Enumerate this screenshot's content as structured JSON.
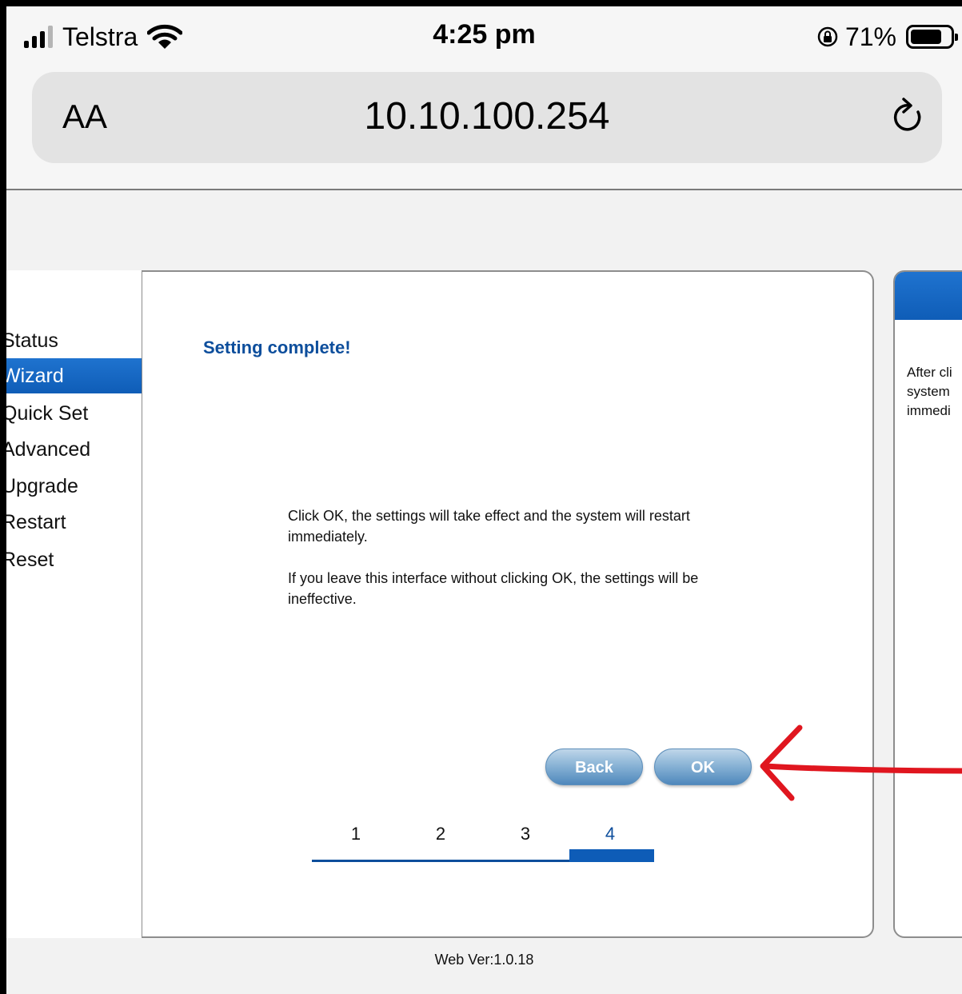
{
  "status_bar": {
    "carrier": "Telstra",
    "time": "4:25 pm",
    "battery_percent": "71%",
    "battery_level": 0.71,
    "signal_bars_filled": 3
  },
  "browser": {
    "text_size_button": "AA",
    "url": "10.10.100.254"
  },
  "sidebar": {
    "items": [
      {
        "label": "Status",
        "active": false
      },
      {
        "label": "Wizard",
        "active": true
      },
      {
        "label": "Quick Set",
        "active": false
      },
      {
        "label": "Advanced",
        "active": false
      },
      {
        "label": "Upgrade",
        "active": false
      },
      {
        "label": "Restart",
        "active": false
      },
      {
        "label": "Reset",
        "active": false
      }
    ]
  },
  "main": {
    "heading": "Setting complete!",
    "paragraph1": "Click OK, the settings will take effect and the system will restart immediately.",
    "paragraph2": "If you leave this interface without clicking OK, the settings will be ineffective.",
    "back_label": "Back",
    "ok_label": "OK",
    "steps": [
      "1",
      "2",
      "3",
      "4"
    ],
    "current_step": "4"
  },
  "help": {
    "text": "After cli\nsystem\nimmedi"
  },
  "footer": {
    "version": "Web Ver:1.0.18"
  },
  "colors": {
    "accent_blue": "#0f5db7",
    "heading_blue": "#0d4e9c",
    "annotation_red": "#e0161f"
  }
}
